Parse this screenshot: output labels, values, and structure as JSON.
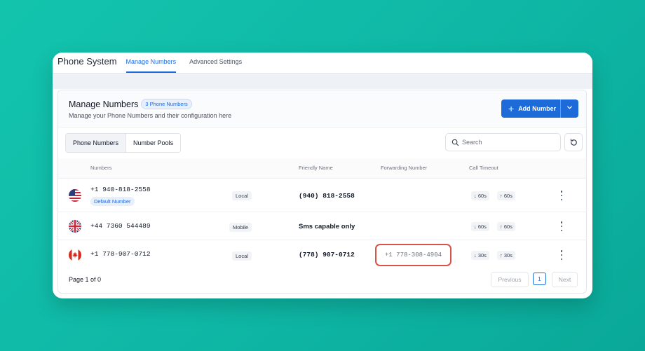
{
  "app": {
    "title": "Phone System",
    "tabs": [
      {
        "label": "Manage Numbers",
        "active": true
      },
      {
        "label": "Advanced Settings",
        "active": false
      }
    ]
  },
  "panel": {
    "title": "Manage Numbers",
    "count_badge": "3 Phone Numbers",
    "subtitle": "Manage your Phone Numbers and their configuration here",
    "add_button": "Add Number"
  },
  "toolbar": {
    "segments": [
      "Phone Numbers",
      "Number Pools"
    ],
    "search_placeholder": "Search"
  },
  "table": {
    "headers": {
      "numbers": "Numbers",
      "friendly": "Friendly Name",
      "forwarding": "Forwarding Number",
      "timeout": "Call Timeout"
    },
    "rows": [
      {
        "flag": "us-flag-icon",
        "number": "+1 940-818-2558",
        "badge": "Default Number",
        "type": "Local",
        "friendly": "(940) 818-2558",
        "forwarding": "",
        "timeout_in": "60s",
        "timeout_out": "60s"
      },
      {
        "flag": "uk-flag-icon",
        "number": "+44 7360 544489",
        "badge": "",
        "type": "Mobile",
        "friendly": "Sms capable only",
        "forwarding": "",
        "timeout_in": "60s",
        "timeout_out": "60s"
      },
      {
        "flag": "ca-flag-icon",
        "number": "+1 778-907-0712",
        "badge": "",
        "type": "Local",
        "friendly": "(778) 907-0712",
        "forwarding": "+1 778-308-4904",
        "timeout_in": "30s",
        "timeout_out": "30s"
      }
    ]
  },
  "pagination": {
    "info": "Page 1 of 0",
    "previous": "Previous",
    "current": "1",
    "next": "Next"
  },
  "colors": {
    "accent": "#1d6ad9",
    "highlight": "#d9534a",
    "background": "#13c4ad"
  }
}
